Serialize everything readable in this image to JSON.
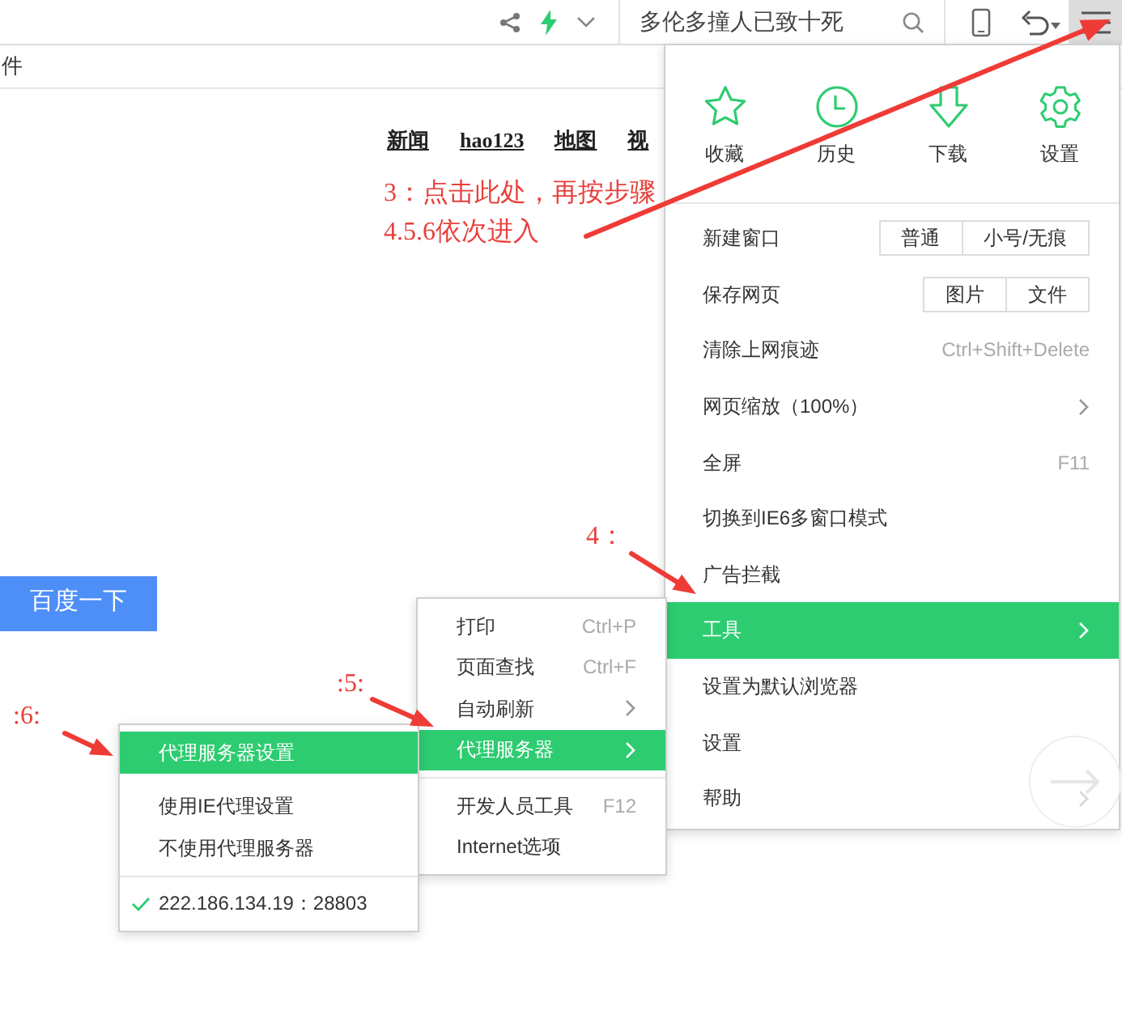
{
  "toolbar": {
    "search_text": "多伦多撞人已致十死"
  },
  "address_row": {
    "text": "件"
  },
  "nav_links": [
    "新闻",
    "hao123",
    "地图",
    "视"
  ],
  "search_button": "百度一下",
  "main_menu": {
    "quick_actions": [
      {
        "label": "收藏"
      },
      {
        "label": "历史"
      },
      {
        "label": "下载"
      },
      {
        "label": "设置"
      }
    ],
    "items": [
      {
        "kind": "buttons",
        "label": "新建窗口",
        "buttons": [
          "普通",
          "小号/无痕"
        ],
        "selected": false
      },
      {
        "kind": "buttons",
        "label": "保存网页",
        "buttons": [
          "图片",
          "文件"
        ],
        "selected": false
      },
      {
        "kind": "shortcut",
        "label": "清除上网痕迹",
        "shortcut": "Ctrl+Shift+Delete",
        "selected": false
      },
      {
        "kind": "submenu",
        "label": "网页缩放（100%）",
        "selected": false
      },
      {
        "kind": "shortcut",
        "label": "全屏",
        "shortcut": "F11",
        "selected": false
      },
      {
        "kind": "plain",
        "label": "切换到IE6多窗口模式",
        "selected": false
      },
      {
        "kind": "plain",
        "label": "广告拦截",
        "selected": false
      },
      {
        "kind": "submenu",
        "label": "工具",
        "selected": true
      },
      {
        "kind": "plain",
        "label": "设置为默认浏览器",
        "selected": false
      },
      {
        "kind": "plain",
        "label": "设置",
        "selected": false
      },
      {
        "kind": "submenu",
        "label": "帮助",
        "selected": false
      }
    ]
  },
  "tools_menu": {
    "groups": [
      [
        {
          "kind": "shortcut",
          "label": "打印",
          "shortcut": "Ctrl+P",
          "selected": false
        },
        {
          "kind": "shortcut",
          "label": "页面查找",
          "shortcut": "Ctrl+F",
          "selected": false
        },
        {
          "kind": "submenu",
          "label": "自动刷新",
          "selected": false
        },
        {
          "kind": "submenu",
          "label": "代理服务器",
          "selected": true
        }
      ],
      [
        {
          "kind": "shortcut",
          "label": "开发人员工具",
          "shortcut": "F12",
          "selected": false
        },
        {
          "kind": "plain",
          "label": "Internet选项",
          "selected": false
        }
      ]
    ]
  },
  "proxy_menu": {
    "groups": [
      [
        {
          "label": "代理服务器设置",
          "selected": true,
          "checked": false
        }
      ],
      [
        {
          "label": "使用IE代理设置",
          "selected": false,
          "checked": false
        },
        {
          "label": "不使用代理服务器",
          "selected": false,
          "checked": false
        }
      ],
      [
        {
          "label": "222.186.134.19：28803",
          "selected": false,
          "checked": true
        }
      ]
    ]
  },
  "annotations": [
    "3：点击此处，再按步骤",
    "4.5.6依次进入",
    "4：",
    ":5:",
    ":6:"
  ]
}
